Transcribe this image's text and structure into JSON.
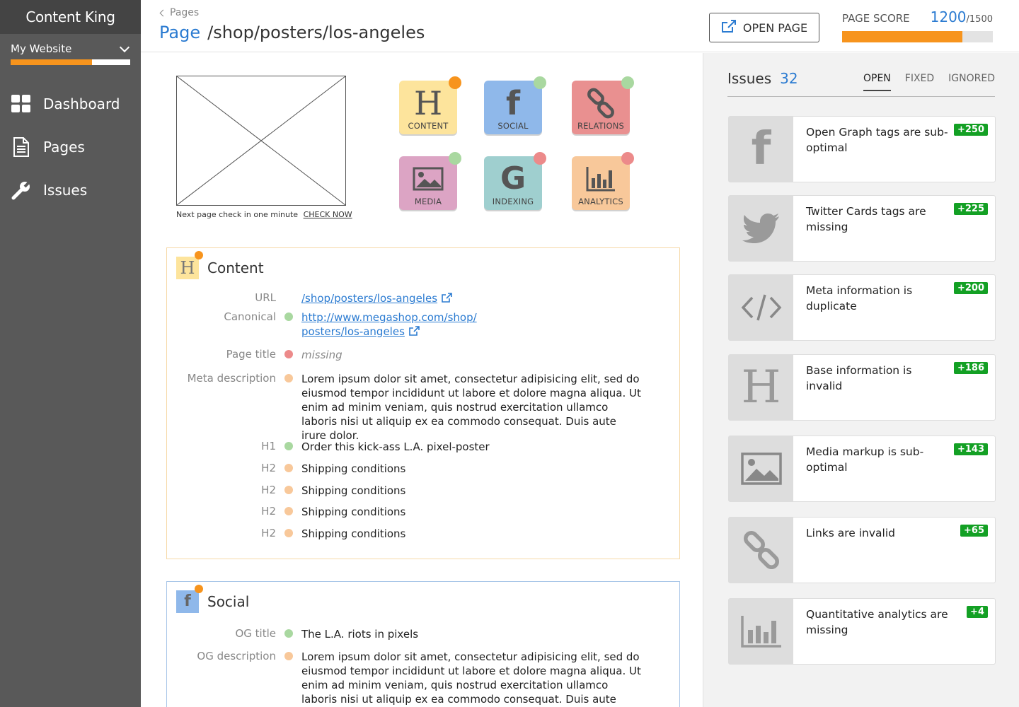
{
  "app": {
    "brand": "Content King"
  },
  "sidebar": {
    "site": "My Website",
    "site_progress": 0.68,
    "items": [
      {
        "label": "Dashboard",
        "icon": "dashboard-icon"
      },
      {
        "label": "Pages",
        "icon": "page-icon"
      },
      {
        "label": "Issues",
        "icon": "wrench-icon"
      }
    ]
  },
  "header": {
    "breadcrumb": "Pages",
    "title_prefix": "Page",
    "title_path": "/shop/posters/los-angeles",
    "open_button": "OPEN PAGE",
    "score_label": "PAGE SCORE",
    "score_value": "1200",
    "score_max": "/1500",
    "score_fraction": 0.8
  },
  "preview": {
    "check_text": "Next page check in one minute",
    "check_link": "CHECK NOW"
  },
  "tiles": [
    {
      "label": "CONTENT",
      "icon": "heading-icon",
      "bg": "#fde49c",
      "dot": "#f7941d"
    },
    {
      "label": "SOCIAL",
      "icon": "facebook-icon",
      "bg": "#8fb8ea",
      "dot": "#a9d8a0"
    },
    {
      "label": "RELATIONS",
      "icon": "chain-link-icon",
      "bg": "#e99090",
      "dot": "#a9d8a0"
    },
    {
      "label": "MEDIA",
      "icon": "image-icon",
      "bg": "#dca4c4",
      "dot": "#a9d8a0"
    },
    {
      "label": "INDEXING",
      "icon": "google-icon",
      "bg": "#9fcfcf",
      "dot": "#ec8a8a"
    },
    {
      "label": "ANALYTICS",
      "icon": "bar-chart-icon",
      "bg": "#f8c89a",
      "dot": "#ec8a8a"
    }
  ],
  "content_panel": {
    "title": "Content",
    "url_label": "URL",
    "url": "/shop/posters/los-angeles",
    "canonical_label": "Canonical",
    "canonical_line1": "http://www.megashop.com/shop/",
    "canonical_line2": "posters/los-angeles",
    "page_title_label": "Page title",
    "page_title_value": "missing",
    "meta_label": "Meta description",
    "meta_value": "Lorem ipsum dolor sit amet, consectetur adipisicing elit, sed do eiusmod tempor incididunt ut labore et dolore magna aliqua. Ut enim ad minim veniam, quis nostrud exercitation ullamco laboris nisi ut aliquip ex ea commodo consequat. Duis aute irure dolor.",
    "headings": [
      {
        "label": "H1",
        "value": "Order this kick-ass L.A. pixel-poster",
        "status": "#a9d8a0"
      },
      {
        "label": "H2",
        "value": "Shipping conditions",
        "status": "#f8c89a"
      },
      {
        "label": "H2",
        "value": "Shipping conditions",
        "status": "#f8c89a"
      },
      {
        "label": "H2",
        "value": "Shipping conditions",
        "status": "#f8c89a"
      },
      {
        "label": "H2",
        "value": "Shipping conditions",
        "status": "#f8c89a"
      }
    ]
  },
  "social_panel": {
    "title": "Social",
    "og_title_label": "OG title",
    "og_title_value": "The L.A. riots in pixels",
    "og_desc_label": "OG description",
    "og_desc_value": "Lorem ipsum dolor sit amet, consectetur adipisicing elit, sed do eiusmod tempor incididunt ut labore et dolore magna aliqua. Ut enim ad minim veniam, quis nostrud exercitation ullamco laboris nisi ut aliquip ex ea commodo consequat. Duis aute irure dolor."
  },
  "issues": {
    "title": "Issues",
    "count": "32",
    "tabs": [
      "OPEN",
      "FIXED",
      "IGNORED"
    ],
    "items": [
      {
        "text": "Open Graph tags are sub-optimal",
        "points": "+250",
        "icon": "facebook-icon"
      },
      {
        "text": "Twitter Cards tags are missing",
        "points": "+225",
        "icon": "twitter-icon"
      },
      {
        "text": "Meta information is duplicate",
        "points": "+200",
        "icon": "code-icon"
      },
      {
        "text": "Base information is invalid",
        "points": "+186",
        "icon": "heading-icon"
      },
      {
        "text": "Media markup is sub-optimal",
        "points": "+143",
        "icon": "image-icon"
      },
      {
        "text": "Links are invalid",
        "points": "+65",
        "icon": "chain-link-icon"
      },
      {
        "text": "Quantitative analytics are missing",
        "points": "+4",
        "icon": "bar-chart-icon"
      }
    ]
  },
  "colors": {
    "accent": "#f7941d",
    "link": "#2b7bd1",
    "ok": "#a9d8a0",
    "warn": "#f8c89a",
    "error": "#ec8a8a",
    "badge": "#13a024"
  }
}
